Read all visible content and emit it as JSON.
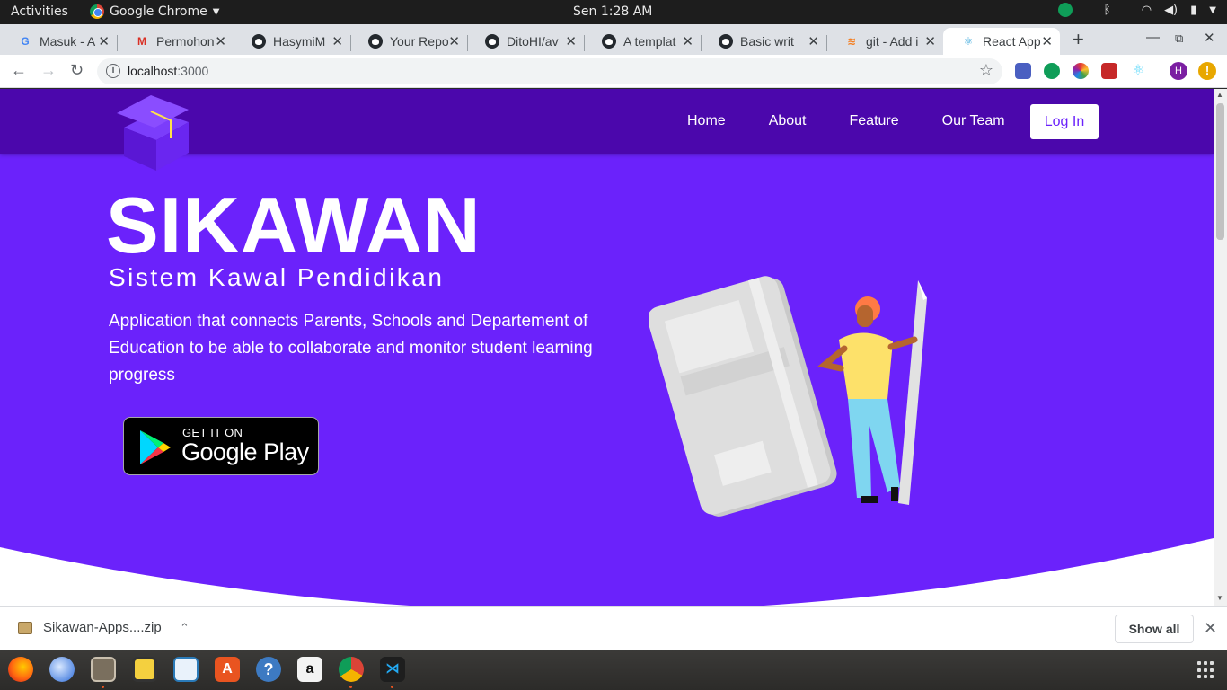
{
  "system_bar": {
    "activities": "Activities",
    "app_name": "Google Chrome",
    "clock": "Sen  1:28 AM"
  },
  "tabs": [
    {
      "title": "Masuk - A",
      "icon": "google-icon"
    },
    {
      "title": "Permohon",
      "icon": "gmail-icon"
    },
    {
      "title": "HasymiM",
      "icon": "github-icon"
    },
    {
      "title": "Your Repo",
      "icon": "github-icon"
    },
    {
      "title": "DitoHI/av",
      "icon": "github-icon"
    },
    {
      "title": "A templat",
      "icon": "github-icon"
    },
    {
      "title": "Basic writ",
      "icon": "github-icon"
    },
    {
      "title": "git - Add i",
      "icon": "stackoverflow-icon"
    },
    {
      "title": "React App",
      "icon": "react-icon",
      "active": true
    }
  ],
  "address": {
    "host": "localhost",
    "port": ":3000"
  },
  "profile_initial": "H",
  "update_mark": "!",
  "site": {
    "nav": [
      "Home",
      "About",
      "Feature",
      "Our Team"
    ],
    "login": "Log In",
    "title": "SIKAWAN",
    "subtitle": "Sistem Kawal Pendidikan",
    "description": "Application that connects Parents, Schools and Departement of Education to be able to collaborate and monitor student learning progress",
    "store_badge": {
      "line1": "GET IT ON",
      "line2": "Google Play"
    },
    "colors": {
      "hero": "#6b22fb",
      "navbar": "#4b07ac"
    }
  },
  "download": {
    "file": "Sikawan-Apps....zip",
    "show_all": "Show all"
  }
}
